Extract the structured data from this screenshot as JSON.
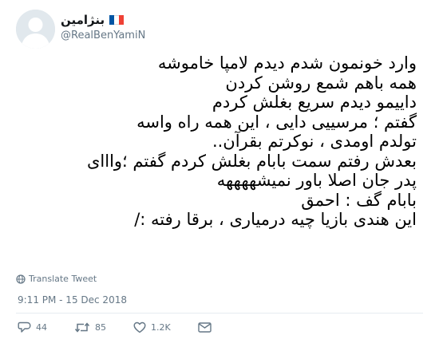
{
  "author": {
    "display_name": "بنژامین",
    "handle": "@RealBenYamiN",
    "avatar_icon": "default-avatar-icon",
    "flag_icon": "france-flag-icon",
    "flag_colors": [
      "#0055a4",
      "#ffffff",
      "#ef4135"
    ]
  },
  "tweet": {
    "lines": [
      "وارد خونمون شدم دیدم لامپا خاموشه",
      "همه باهم شمع روشن کردن",
      "داییمو دیدم سریع بغلش کردم",
      "گفتم ؛ مرسییی دایی ، این همه راه واسه",
      "تولدم اومدی ، نوکرتم بقرآن..",
      "بعدش رفتم سمت بابام بغلش کردم گفتم ؛وااای",
      "پدر جان اصلا باور نمیشههههه",
      "بابام گف : احمق",
      "این هندی بازیا چیه درمیاری ، برقا رفته :/"
    ],
    "translate_label": "Translate Tweet",
    "timestamp": "9:11 PM - 15 Dec 2018"
  },
  "actions": {
    "replies": "44",
    "retweets": "85",
    "likes": "1.2K"
  },
  "colors": {
    "secondary_text": "#657786",
    "divider": "#e6ecf0"
  }
}
